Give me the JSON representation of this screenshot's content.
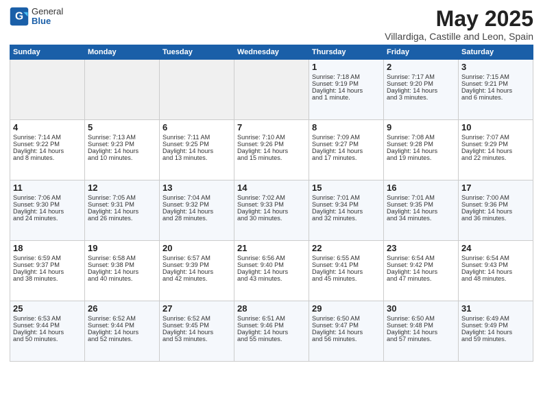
{
  "header": {
    "logo_general": "General",
    "logo_blue": "Blue",
    "month_title": "May 2025",
    "subtitle": "Villardiga, Castille and Leon, Spain"
  },
  "weekdays": [
    "Sunday",
    "Monday",
    "Tuesday",
    "Wednesday",
    "Thursday",
    "Friday",
    "Saturday"
  ],
  "weeks": [
    [
      {
        "day": "",
        "lines": []
      },
      {
        "day": "",
        "lines": []
      },
      {
        "day": "",
        "lines": []
      },
      {
        "day": "",
        "lines": []
      },
      {
        "day": "1",
        "lines": [
          "Sunrise: 7:18 AM",
          "Sunset: 9:19 PM",
          "Daylight: 14 hours",
          "and 1 minute."
        ]
      },
      {
        "day": "2",
        "lines": [
          "Sunrise: 7:17 AM",
          "Sunset: 9:20 PM",
          "Daylight: 14 hours",
          "and 3 minutes."
        ]
      },
      {
        "day": "3",
        "lines": [
          "Sunrise: 7:15 AM",
          "Sunset: 9:21 PM",
          "Daylight: 14 hours",
          "and 6 minutes."
        ]
      }
    ],
    [
      {
        "day": "4",
        "lines": [
          "Sunrise: 7:14 AM",
          "Sunset: 9:22 PM",
          "Daylight: 14 hours",
          "and 8 minutes."
        ]
      },
      {
        "day": "5",
        "lines": [
          "Sunrise: 7:13 AM",
          "Sunset: 9:23 PM",
          "Daylight: 14 hours",
          "and 10 minutes."
        ]
      },
      {
        "day": "6",
        "lines": [
          "Sunrise: 7:11 AM",
          "Sunset: 9:25 PM",
          "Daylight: 14 hours",
          "and 13 minutes."
        ]
      },
      {
        "day": "7",
        "lines": [
          "Sunrise: 7:10 AM",
          "Sunset: 9:26 PM",
          "Daylight: 14 hours",
          "and 15 minutes."
        ]
      },
      {
        "day": "8",
        "lines": [
          "Sunrise: 7:09 AM",
          "Sunset: 9:27 PM",
          "Daylight: 14 hours",
          "and 17 minutes."
        ]
      },
      {
        "day": "9",
        "lines": [
          "Sunrise: 7:08 AM",
          "Sunset: 9:28 PM",
          "Daylight: 14 hours",
          "and 19 minutes."
        ]
      },
      {
        "day": "10",
        "lines": [
          "Sunrise: 7:07 AM",
          "Sunset: 9:29 PM",
          "Daylight: 14 hours",
          "and 22 minutes."
        ]
      }
    ],
    [
      {
        "day": "11",
        "lines": [
          "Sunrise: 7:06 AM",
          "Sunset: 9:30 PM",
          "Daylight: 14 hours",
          "and 24 minutes."
        ]
      },
      {
        "day": "12",
        "lines": [
          "Sunrise: 7:05 AM",
          "Sunset: 9:31 PM",
          "Daylight: 14 hours",
          "and 26 minutes."
        ]
      },
      {
        "day": "13",
        "lines": [
          "Sunrise: 7:04 AM",
          "Sunset: 9:32 PM",
          "Daylight: 14 hours",
          "and 28 minutes."
        ]
      },
      {
        "day": "14",
        "lines": [
          "Sunrise: 7:02 AM",
          "Sunset: 9:33 PM",
          "Daylight: 14 hours",
          "and 30 minutes."
        ]
      },
      {
        "day": "15",
        "lines": [
          "Sunrise: 7:01 AM",
          "Sunset: 9:34 PM",
          "Daylight: 14 hours",
          "and 32 minutes."
        ]
      },
      {
        "day": "16",
        "lines": [
          "Sunrise: 7:01 AM",
          "Sunset: 9:35 PM",
          "Daylight: 14 hours",
          "and 34 minutes."
        ]
      },
      {
        "day": "17",
        "lines": [
          "Sunrise: 7:00 AM",
          "Sunset: 9:36 PM",
          "Daylight: 14 hours",
          "and 36 minutes."
        ]
      }
    ],
    [
      {
        "day": "18",
        "lines": [
          "Sunrise: 6:59 AM",
          "Sunset: 9:37 PM",
          "Daylight: 14 hours",
          "and 38 minutes."
        ]
      },
      {
        "day": "19",
        "lines": [
          "Sunrise: 6:58 AM",
          "Sunset: 9:38 PM",
          "Daylight: 14 hours",
          "and 40 minutes."
        ]
      },
      {
        "day": "20",
        "lines": [
          "Sunrise: 6:57 AM",
          "Sunset: 9:39 PM",
          "Daylight: 14 hours",
          "and 42 minutes."
        ]
      },
      {
        "day": "21",
        "lines": [
          "Sunrise: 6:56 AM",
          "Sunset: 9:40 PM",
          "Daylight: 14 hours",
          "and 43 minutes."
        ]
      },
      {
        "day": "22",
        "lines": [
          "Sunrise: 6:55 AM",
          "Sunset: 9:41 PM",
          "Daylight: 14 hours",
          "and 45 minutes."
        ]
      },
      {
        "day": "23",
        "lines": [
          "Sunrise: 6:54 AM",
          "Sunset: 9:42 PM",
          "Daylight: 14 hours",
          "and 47 minutes."
        ]
      },
      {
        "day": "24",
        "lines": [
          "Sunrise: 6:54 AM",
          "Sunset: 9:43 PM",
          "Daylight: 14 hours",
          "and 48 minutes."
        ]
      }
    ],
    [
      {
        "day": "25",
        "lines": [
          "Sunrise: 6:53 AM",
          "Sunset: 9:44 PM",
          "Daylight: 14 hours",
          "and 50 minutes."
        ]
      },
      {
        "day": "26",
        "lines": [
          "Sunrise: 6:52 AM",
          "Sunset: 9:44 PM",
          "Daylight: 14 hours",
          "and 52 minutes."
        ]
      },
      {
        "day": "27",
        "lines": [
          "Sunrise: 6:52 AM",
          "Sunset: 9:45 PM",
          "Daylight: 14 hours",
          "and 53 minutes."
        ]
      },
      {
        "day": "28",
        "lines": [
          "Sunrise: 6:51 AM",
          "Sunset: 9:46 PM",
          "Daylight: 14 hours",
          "and 55 minutes."
        ]
      },
      {
        "day": "29",
        "lines": [
          "Sunrise: 6:50 AM",
          "Sunset: 9:47 PM",
          "Daylight: 14 hours",
          "and 56 minutes."
        ]
      },
      {
        "day": "30",
        "lines": [
          "Sunrise: 6:50 AM",
          "Sunset: 9:48 PM",
          "Daylight: 14 hours",
          "and 57 minutes."
        ]
      },
      {
        "day": "31",
        "lines": [
          "Sunrise: 6:49 AM",
          "Sunset: 9:49 PM",
          "Daylight: 14 hours",
          "and 59 minutes."
        ]
      }
    ]
  ]
}
